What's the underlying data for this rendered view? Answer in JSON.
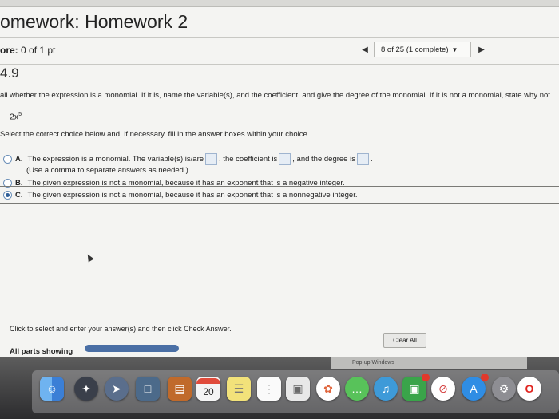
{
  "header": {
    "title": "omework: Homework 2",
    "score_label": "ore:",
    "score_value": "0 of 1 pt"
  },
  "navigation": {
    "progress_text": "8 of 25 (1 complete)",
    "prev_icon": "triangle-left",
    "next_icon": "triangle-right",
    "dropdown_icon": "triangle-down"
  },
  "question": {
    "number": "4.9",
    "instruction": "all whether the expression is a monomial. If it is, name the variable(s), and the coefficient, and give the degree of the monomial. If it is not a monomial, state why not.",
    "expression_base": "2x",
    "expression_exponent": "5",
    "select_note": "Select the correct choice below and, if necessary, fill in the answer boxes within your choice."
  },
  "choices": [
    {
      "letter": "A.",
      "text_1": "The expression is a monomial. The variable(s) is/are",
      "text_2": ", the coefficient is",
      "text_3": ", and the degree is",
      "text_4": ".",
      "note": "(Use a comma to separate answers as needed.)",
      "selected": false
    },
    {
      "letter": "B.",
      "text": "The given expression is not a monomial, because it has an exponent that is a negative integer.",
      "selected": false
    },
    {
      "letter": "C.",
      "text": "The given expression is not a monomial, because it has an exponent that is a nonnegative integer.",
      "selected": true
    }
  ],
  "footer": {
    "instruction": "Click to select and enter your answer(s) and then click Check Answer.",
    "parts_label": "All parts showing",
    "clear_label": "Clear All",
    "progress_fraction": 1.0
  },
  "taskbar": {
    "popup_label": "Pop-up Windows",
    "calendar_day": "20"
  },
  "dock_icons": [
    "finder-icon",
    "launchpad-icon",
    "rocket-icon",
    "preview-icon",
    "books-icon",
    "calendar-icon",
    "notes-icon",
    "reminders-icon",
    "photos-icon",
    "photos-flower-icon",
    "messages-icon",
    "facetime-icon",
    "itunes-icon",
    "news-icon",
    "app-store-icon",
    "system-preferences-icon",
    "opera-icon"
  ]
}
